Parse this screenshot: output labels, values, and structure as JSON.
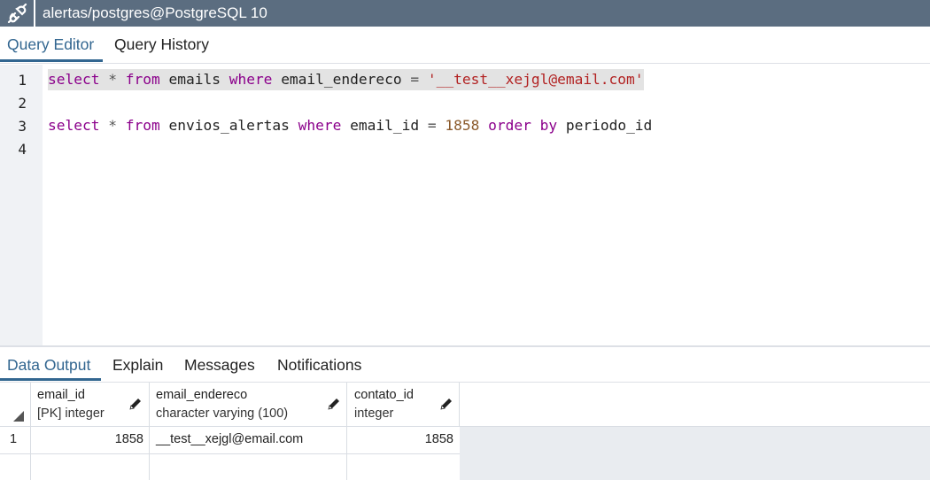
{
  "window": {
    "title": "alertas/postgres@PostgreSQL 10"
  },
  "editor_tabs": [
    {
      "label": "Query Editor",
      "active": true
    },
    {
      "label": "Query History",
      "active": false
    }
  ],
  "editor": {
    "line_numbers": [
      "1",
      "2",
      "3",
      "4"
    ],
    "line1": {
      "kw_select": "select",
      "star": "*",
      "kw_from": "from",
      "table": "emails",
      "kw_where": "where",
      "column": "email_endereco",
      "op": "=",
      "string": "'__test__xejgl@email.com'"
    },
    "line3": {
      "kw_select": "select",
      "star": "*",
      "kw_from": "from",
      "table": "envios_alertas",
      "kw_where": "where",
      "column": "email_id",
      "op": "=",
      "number": "1858",
      "kw_order": "order",
      "kw_by": "by",
      "order_column": "periodo_id"
    }
  },
  "output_tabs": [
    {
      "label": "Data Output",
      "active": true
    },
    {
      "label": "Explain",
      "active": false
    },
    {
      "label": "Messages",
      "active": false
    },
    {
      "label": "Notifications",
      "active": false
    }
  ],
  "grid": {
    "columns": [
      {
        "name": "email_id",
        "type": "[PK] integer"
      },
      {
        "name": "email_endereco",
        "type": "character varying (100)"
      },
      {
        "name": "contato_id",
        "type": "integer"
      }
    ],
    "rows": [
      {
        "row_num": "1",
        "cells": [
          "1858",
          "__test__xejgl@email.com",
          "1858"
        ]
      }
    ]
  },
  "colors": {
    "titlebar": "#5b6d80",
    "accent": "#326690",
    "keyword": "#8b008b",
    "string": "#b22222",
    "number": "#8b5a2b"
  }
}
